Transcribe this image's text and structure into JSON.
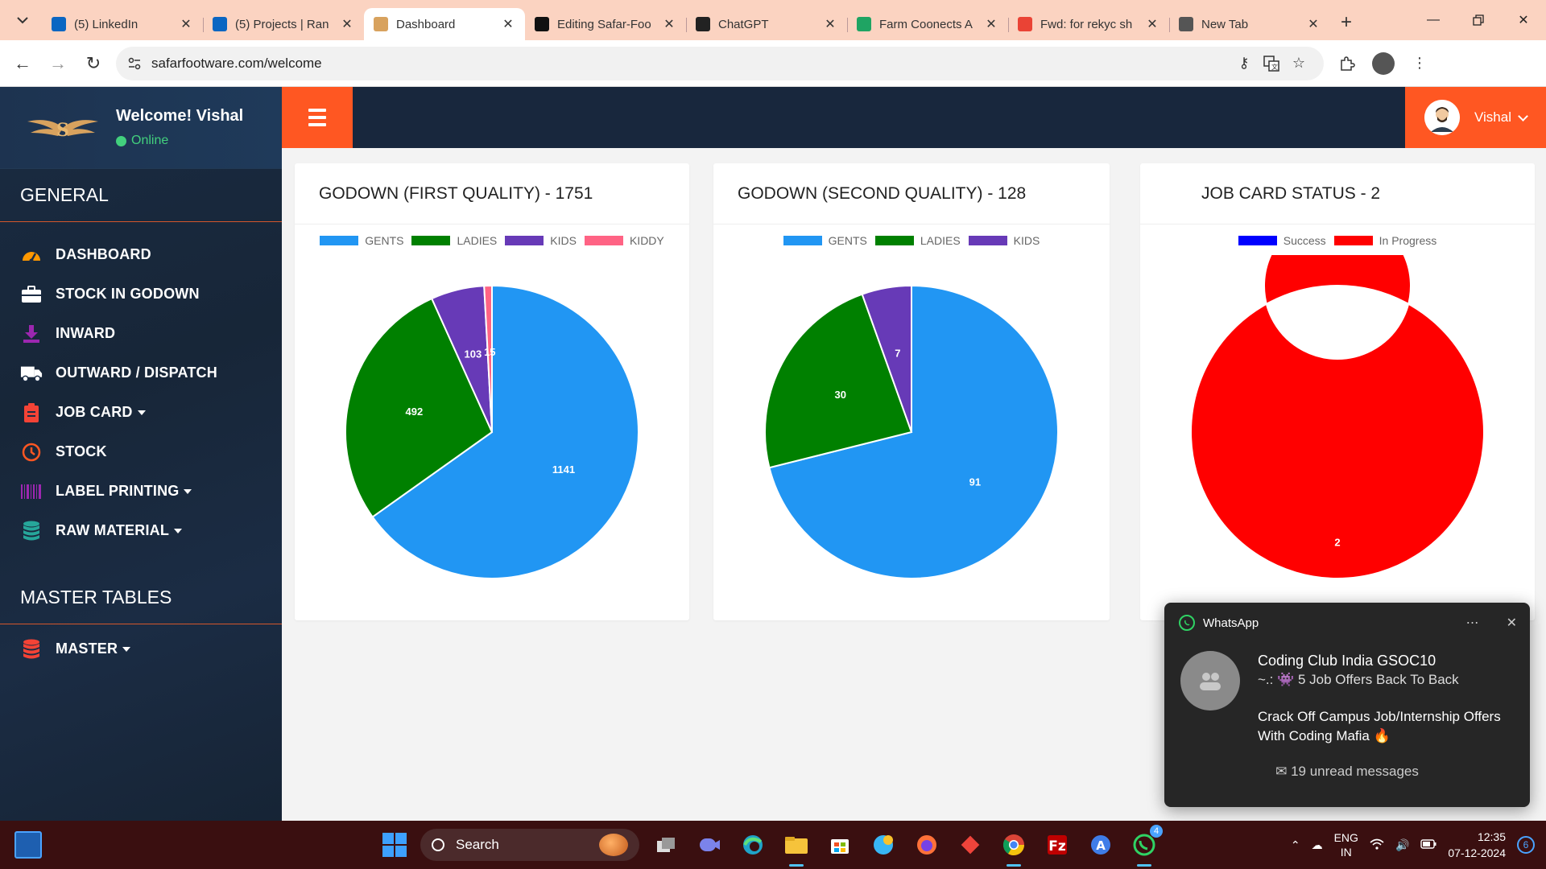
{
  "browser": {
    "tabs": [
      {
        "title": "(5) LinkedIn",
        "icon": "linkedin-icon",
        "color": "#0a66c2",
        "active": false
      },
      {
        "title": "(5) Projects | Ran",
        "icon": "linkedin-icon",
        "color": "#0a66c2",
        "active": false
      },
      {
        "title": "Dashboard",
        "icon": "wings-logo-icon",
        "color": "#d8a25e",
        "active": true
      },
      {
        "title": "Editing Safar-Foo",
        "icon": "github-icon",
        "color": "#111111",
        "active": false
      },
      {
        "title": "ChatGPT",
        "icon": "chatgpt-icon",
        "color": "#222222",
        "active": false
      },
      {
        "title": "Farm Coonects A",
        "icon": "google-drive-icon",
        "color": "#1fa463",
        "active": false
      },
      {
        "title": "Fwd: for rekyc sh",
        "icon": "gmail-icon",
        "color": "#ea4335",
        "active": false
      },
      {
        "title": "New Tab",
        "icon": "chrome-icon",
        "color": "#555555",
        "active": false
      }
    ],
    "url": "safarfootware.com/welcome"
  },
  "sidebar": {
    "welcome": "Welcome! Vishal",
    "status": "Online",
    "general_heading": "GENERAL",
    "general_items": [
      {
        "label": "DASHBOARD",
        "icon": "dashboard-gauge-icon",
        "color": "#ff9800",
        "dropdown": false
      },
      {
        "label": "STOCK IN GODOWN",
        "icon": "briefcase-icon",
        "color": "#ffffff",
        "dropdown": false
      },
      {
        "label": "INWARD",
        "icon": "download-icon",
        "color": "#9c27b0",
        "dropdown": false
      },
      {
        "label": "OUTWARD / DISPATCH",
        "icon": "truck-icon",
        "color": "#ffffff",
        "dropdown": false
      },
      {
        "label": "JOB CARD",
        "icon": "clipboard-icon",
        "color": "#f44336",
        "dropdown": true
      },
      {
        "label": "STOCK",
        "icon": "clock-icon",
        "color": "#ff5722",
        "dropdown": false
      },
      {
        "label": "LABEL PRINTING",
        "icon": "barcode-icon",
        "color": "#9c27b0",
        "dropdown": true
      },
      {
        "label": "RAW MATERIAL",
        "icon": "database-icon",
        "color": "#26a69a",
        "dropdown": true
      }
    ],
    "master_heading": "MASTER TABLES",
    "master_items": [
      {
        "label": "MASTER",
        "icon": "database-icon",
        "color": "#f44336",
        "dropdown": true
      }
    ]
  },
  "topbar": {
    "user": "Vishal"
  },
  "charts_meta": {
    "card1_title": "GODOWN (FIRST QUALITY) - 1751",
    "card2_title": "GODOWN (SECOND QUALITY) - 128",
    "card3_title": "JOB CARD STATUS -  2"
  },
  "chart_data": [
    {
      "type": "pie",
      "title": "GODOWN (FIRST QUALITY) - 1751",
      "categories": [
        "GENTS",
        "LADIES",
        "KIDS",
        "KIDDY"
      ],
      "values": [
        1141,
        492,
        103,
        15
      ],
      "colors": [
        "#2196f3",
        "#008000",
        "#673ab7",
        "#ff6384"
      ],
      "legend": "top"
    },
    {
      "type": "pie",
      "title": "GODOWN (SECOND QUALITY) - 128",
      "categories": [
        "GENTS",
        "LADIES",
        "KIDS"
      ],
      "values": [
        91,
        30,
        7
      ],
      "colors": [
        "#2196f3",
        "#008000",
        "#673ab7"
      ],
      "legend": "top"
    },
    {
      "type": "pie",
      "subtype": "doughnut",
      "title": "JOB CARD STATUS -  2",
      "categories": [
        "Success",
        "In Progress"
      ],
      "values": [
        0,
        2
      ],
      "colors": [
        "#0000ff",
        "#ff0000"
      ],
      "legend": "top"
    }
  ],
  "toast": {
    "app": "WhatsApp",
    "title": "Coding Club India GSOC10",
    "line1": "~.: 👾 5 Job Offers Back To Back",
    "line2": "Crack Off Campus Job/Internship  Offers With Coding Mafia 🔥",
    "footer": "✉ 19 unread messages"
  },
  "taskbar": {
    "search": "Search",
    "lang1": "ENG",
    "lang2": "IN",
    "time": "12:35",
    "date": "07-12-2024",
    "notif_count": "6",
    "whatsapp_badge": "4"
  }
}
